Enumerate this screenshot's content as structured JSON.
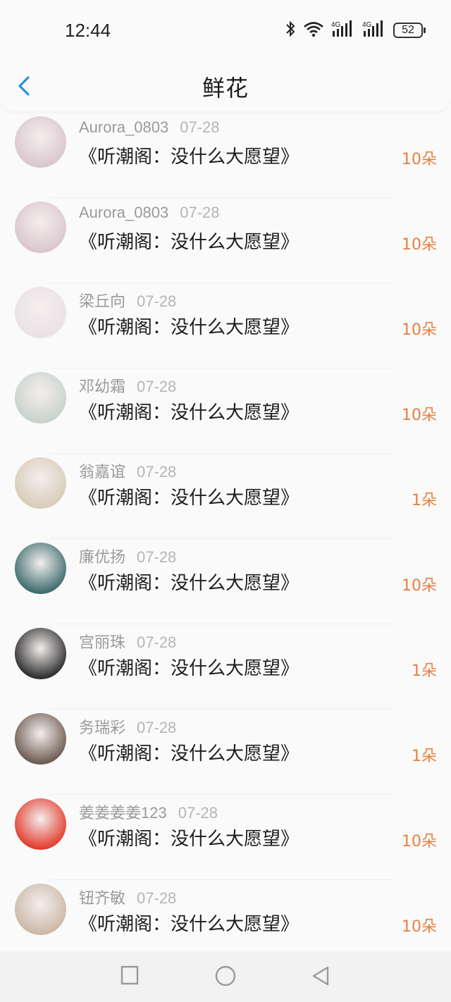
{
  "status": {
    "time": "12:44",
    "battery": "52"
  },
  "header": {
    "title": "鲜花"
  },
  "rows": [
    {
      "name": "Aurora_0803",
      "date": "07-28",
      "book": "《听潮阁：没什么大愿望》",
      "count": "10朵",
      "avatar_color": "#d9c6cc"
    },
    {
      "name": "Aurora_0803",
      "date": "07-28",
      "book": "《听潮阁：没什么大愿望》",
      "count": "10朵",
      "avatar_color": "#d9c6cc"
    },
    {
      "name": "梁丘向",
      "date": "07-28",
      "book": "《听潮阁：没什么大愿望》",
      "count": "10朵",
      "avatar_color": "#e9e2e6"
    },
    {
      "name": "邓幼霜",
      "date": "07-28",
      "book": "《听潮阁：没什么大愿望》",
      "count": "10朵",
      "avatar_color": "#c7d2cc"
    },
    {
      "name": "翁嘉谊",
      "date": "07-28",
      "book": "《听潮阁：没什么大愿望》",
      "count": "1朵",
      "avatar_color": "#d8cbb8"
    },
    {
      "name": "廉优扬",
      "date": "07-28",
      "book": "《听潮阁：没什么大愿望》",
      "count": "10朵",
      "avatar_color": "#3b6a6c"
    },
    {
      "name": "宫丽珠",
      "date": "07-28",
      "book": "《听潮阁：没什么大愿望》",
      "count": "1朵",
      "avatar_color": "#2b2b2b"
    },
    {
      "name": "务瑞彩",
      "date": "07-28",
      "book": "《听潮阁：没什么大愿望》",
      "count": "1朵",
      "avatar_color": "#6b5a50"
    },
    {
      "name": "姜姜姜姜123",
      "date": "07-28",
      "book": "《听潮阁：没什么大愿望》",
      "count": "10朵",
      "avatar_color": "#e23a2a"
    },
    {
      "name": "钮齐敏",
      "date": "07-28",
      "book": "《听潮阁：没什么大愿望》",
      "count": "10朵",
      "avatar_color": "#cbb7a6"
    }
  ],
  "colors": {
    "accent": "#2d8ee0",
    "count": "#e8803f"
  }
}
